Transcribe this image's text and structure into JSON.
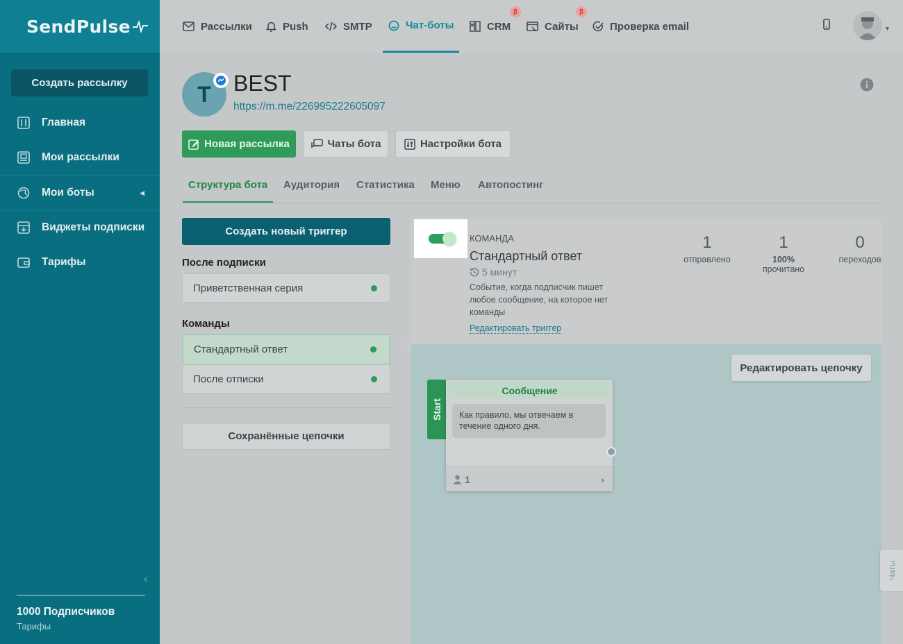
{
  "brand": {
    "logo": "SendPulse"
  },
  "sidebar": {
    "create_label": "Создать рассылку",
    "items": [
      {
        "label": "Главная",
        "icon": "dashboard-icon"
      },
      {
        "label": "Мои рассылки",
        "icon": "campaigns-icon"
      },
      {
        "label": "Мои боты",
        "icon": "bots-icon"
      },
      {
        "label": "Виджеты подписки",
        "icon": "widget-icon"
      },
      {
        "label": "Тарифы",
        "icon": "wallet-icon"
      }
    ],
    "subscribers": "1000 Подписчиков",
    "tariffs_link": "Тарифы"
  },
  "topnav": {
    "items": [
      {
        "label": "Рассылки",
        "icon": "mail-icon"
      },
      {
        "label": "Push",
        "icon": "bell-icon"
      },
      {
        "label": "SMTP",
        "icon": "code-icon"
      },
      {
        "label": "Чат-боты",
        "icon": "chatbot-icon",
        "active": true
      },
      {
        "label": "CRM",
        "icon": "crm-icon",
        "beta": "β"
      },
      {
        "label": "Сайты",
        "icon": "sites-icon",
        "beta": "β"
      },
      {
        "label": "Проверка email",
        "icon": "check-icon"
      }
    ]
  },
  "bot": {
    "avatar_letter": "T",
    "name": "BEST",
    "link": "https://m.me/226995222605097"
  },
  "actions": {
    "new_campaign": "Новая рассылка",
    "bot_chats": "Чаты бота",
    "bot_settings": "Настройки бота"
  },
  "tabs": [
    {
      "label": "Структура бота",
      "active": true
    },
    {
      "label": "Аудитория"
    },
    {
      "label": "Статистика"
    },
    {
      "label": "Меню"
    },
    {
      "label": "Автопостинг"
    }
  ],
  "triggers": {
    "create_label": "Создать новый триггер",
    "after_subscribe_label": "После подписки",
    "after_subscribe": [
      {
        "label": "Приветственная серия"
      }
    ],
    "commands_label": "Команды",
    "commands": [
      {
        "label": "Стандартный ответ",
        "selected": true
      },
      {
        "label": "После отписки"
      }
    ],
    "saved_chains_label": "Сохранённые цепочки"
  },
  "trigger_detail": {
    "enabled": true,
    "type": "КОМАНДА",
    "title": "Стандартный ответ",
    "time": "5 минут",
    "description": "Событие, когда подписчик пишет любое сообщение, на которое нет команды",
    "edit_link": "Редактировать триггер",
    "stats": [
      {
        "value": "1",
        "label": "отправлено"
      },
      {
        "value": "1",
        "pct": "100%",
        "label": "прочитано"
      },
      {
        "value": "0",
        "label": "переходов"
      }
    ]
  },
  "flow": {
    "edit_chain_label": "Редактировать цепочку",
    "start_label": "Start",
    "message": {
      "header": "Сообщение",
      "text": "Как правило, мы отвечаем в течение одного дня.",
      "count": "1"
    }
  },
  "chats_tab": "Чаты",
  "colors": {
    "sidebar": "#096e7f",
    "accent": "#138a9c",
    "green": "#2e9c58"
  }
}
